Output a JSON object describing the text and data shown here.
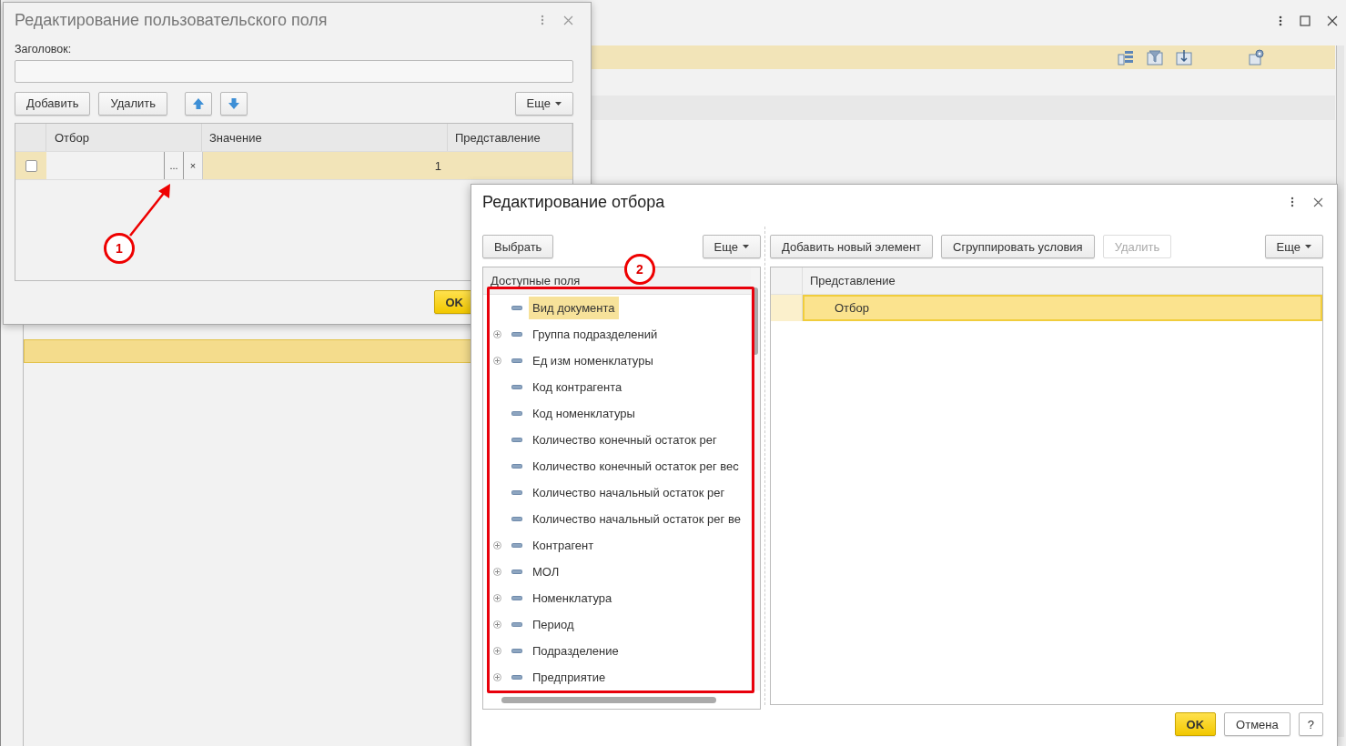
{
  "dialog_field": {
    "title": "Редактирование пользовательского поля",
    "caption_label": "Заголовок:",
    "buttons": [
      "Добавить",
      "Удалить"
    ],
    "more_button": "Еще",
    "table": {
      "columns": [
        "Отбор",
        "Значение",
        "Представление"
      ],
      "rows": [
        {
          "checked": false,
          "selected": true,
          "choose_button": "...",
          "clear_button": "×",
          "value": "1"
        }
      ]
    },
    "ok_button": "OK"
  },
  "dialog_filter": {
    "title": "Редактирование отбора",
    "left_buttons": [
      {
        "label": "Выбрать",
        "disabled": false
      }
    ],
    "left_more": "Еще",
    "right_buttons": [
      {
        "label": "Добавить новый элемент",
        "disabled": false
      },
      {
        "label": "Сгруппировать условия",
        "disabled": false
      },
      {
        "label": "Удалить",
        "disabled": true
      }
    ],
    "right_more": "Еще",
    "fields_header": "Доступные поля",
    "fields": [
      {
        "label": "Вид документа",
        "expandable": false,
        "selected": true
      },
      {
        "label": "Группа подразделений",
        "expandable": true,
        "selected": false
      },
      {
        "label": "Ед изм номенклатуры",
        "expandable": true,
        "selected": false
      },
      {
        "label": "Код контрагента",
        "expandable": false,
        "selected": false
      },
      {
        "label": "Код номенклатуры",
        "expandable": false,
        "selected": false
      },
      {
        "label": "Количество конечный остаток рег",
        "expandable": false,
        "selected": false
      },
      {
        "label": "Количество конечный остаток рег вес",
        "expandable": false,
        "selected": false
      },
      {
        "label": "Количество начальный остаток рег",
        "expandable": false,
        "selected": false
      },
      {
        "label": "Количество начальный остаток рег ве",
        "expandable": false,
        "selected": false
      },
      {
        "label": "Контрагент",
        "expandable": true,
        "selected": false
      },
      {
        "label": "МОЛ",
        "expandable": true,
        "selected": false
      },
      {
        "label": "Номенклатура",
        "expandable": true,
        "selected": false
      },
      {
        "label": "Период",
        "expandable": true,
        "selected": false
      },
      {
        "label": "Подразделение",
        "expandable": true,
        "selected": false
      },
      {
        "label": "Предприятие",
        "expandable": true,
        "selected": false
      }
    ],
    "conditions_header": "Представление",
    "conditions": [
      {
        "label": "Отбор",
        "selected": true
      }
    ],
    "footer_buttons": [
      {
        "label": "OK",
        "kind": "primary"
      },
      {
        "label": "Отмена",
        "kind": "normal"
      },
      {
        "label": "?",
        "kind": "normal"
      }
    ]
  },
  "annotations": [
    {
      "label": "1"
    },
    {
      "label": "2"
    }
  ]
}
